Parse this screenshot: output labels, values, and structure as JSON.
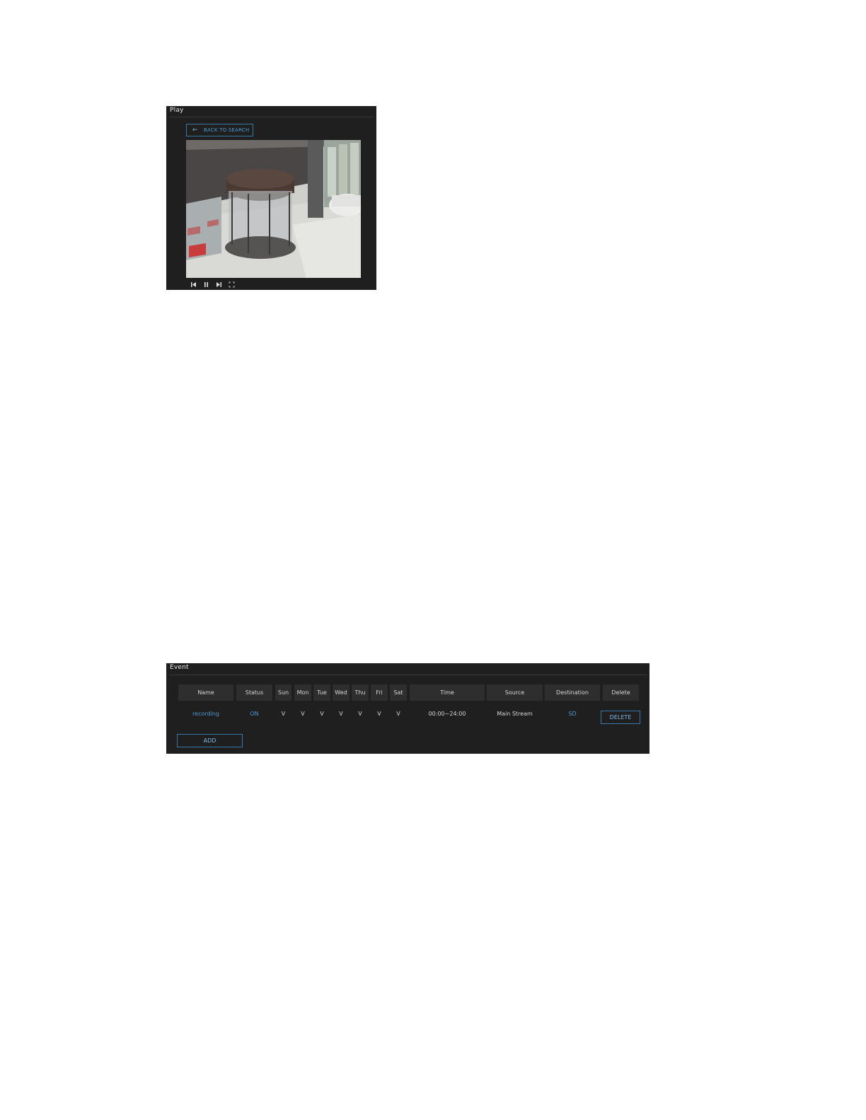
{
  "play": {
    "title": "Play",
    "back_button": {
      "icon": "arrow-left-icon",
      "label": "BACK TO SEARCH"
    },
    "video": {
      "description": "camera-view-revolving-door-lobby"
    },
    "controls": [
      "skip-back-icon",
      "pause-icon",
      "skip-forward-icon",
      "fullscreen-icon"
    ]
  },
  "event": {
    "title": "Event",
    "columns": [
      "Name",
      "Status",
      "Sun",
      "Mon",
      "Tue",
      "Wed",
      "Thu",
      "Fri",
      "Sat",
      "Time",
      "Source",
      "Destination",
      "Delete"
    ],
    "rows": [
      {
        "name": "recording",
        "status": "ON",
        "sun": "V",
        "mon": "V",
        "tue": "V",
        "wed": "V",
        "thu": "V",
        "fri": "V",
        "sat": "V",
        "time": "00:00~24:00",
        "source": "Main Stream",
        "destination": "SD",
        "delete_label": "DELETE"
      }
    ],
    "add_label": "ADD"
  },
  "colors": {
    "panel_bg": "#1f1f1f",
    "header_bg": "#2e2e2e",
    "accent": "#4c9ad6",
    "text": "#d6d6d6"
  }
}
